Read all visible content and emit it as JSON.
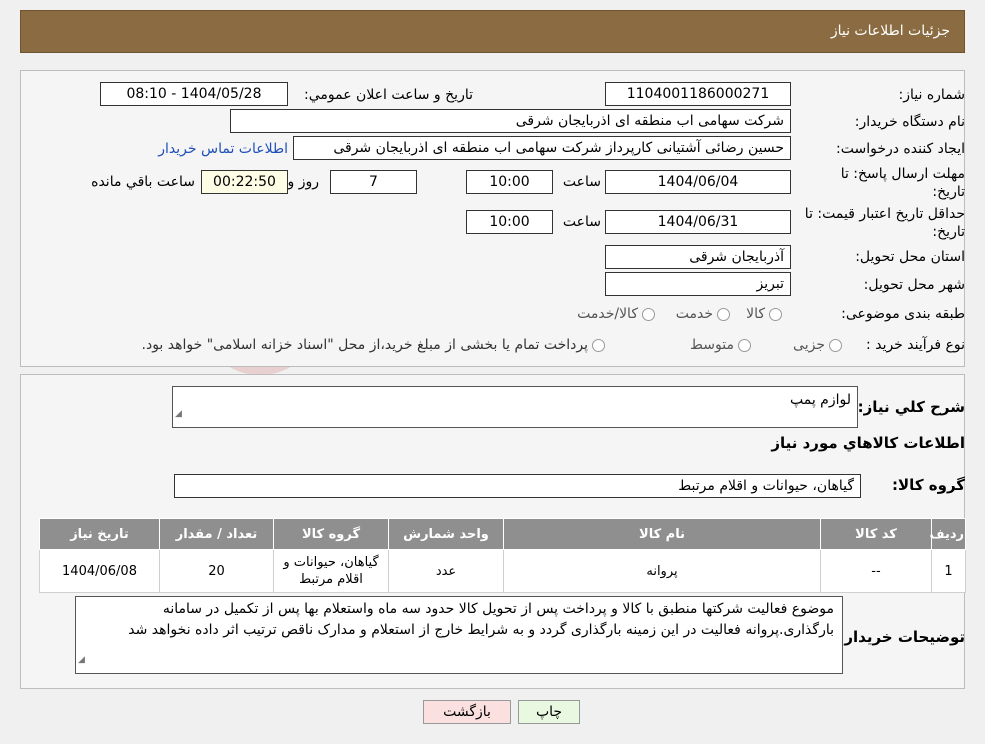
{
  "header": {
    "title": "جزئیات اطلاعات نیاز"
  },
  "form": {
    "need_number_label": "شماره نیاز:",
    "need_number": "1104001186000271",
    "announce_label": "تاریخ و ساعت اعلان عمومي:",
    "announce_value": "1404/05/28 - 08:10",
    "buyer_org_label": "نام دستگاه خريدار:",
    "buyer_org": "شرکت سهامی اب منطقه ای اذربایجان شرقی",
    "creator_label": "ايجاد كننده درخواست:",
    "creator": "حسین رضائی آشتیانی کارپرداز شرکت سهامی اب منطقه ای اذربایجان شرقی",
    "contact_link": "اطلاعات تماس خریدار",
    "deadline_label_1": "مهلت ارسال پاسخ: تا",
    "deadline_label_2": "تاريخ:",
    "deadline_date": "1404/06/04",
    "time_label": "ساعت",
    "deadline_time": "10:00",
    "days_value": "7",
    "days_label": "روز و",
    "remaining_time": "00:22:50",
    "remaining_label": "ساعت باقي مانده",
    "validity_label_1": "حداقل تاريخ اعتبار قيمت: تا",
    "validity_label_2": "تاريخ:",
    "validity_date": "1404/06/31",
    "validity_time_label": "ساعت",
    "validity_time": "10:00",
    "province_label": "استان محل تحويل:",
    "province": "آذربایجان شرقی",
    "city_label": "شهر محل تحويل:",
    "city": "تبریز",
    "category_label": "طبقه بندی موضوعی:",
    "category_options": [
      "کالا",
      "خدمت",
      "کالا/خدمت"
    ],
    "process_label": "نوع فرآيند خريد :",
    "process_options": [
      "جزیی",
      "متوسط"
    ],
    "process_note": "پرداخت تمام یا بخشی از مبلغ خرید،از محل \"اسناد خزانه اسلامی\" خواهد بود."
  },
  "summary": {
    "label": "شرح كلي نياز:",
    "value": "لوازم پمپ",
    "goods_info_title": "اطلاعات كالاهاي مورد نياز",
    "group_label": "گروه کالا:",
    "group_value": "گیاهان، حیوانات و اقلام مرتبط"
  },
  "table": {
    "headers": [
      "رديف",
      "كد كالا",
      "نام كالا",
      "واحد شمارش",
      "گروه كالا",
      "تعداد / مقدار",
      "تاريخ نياز"
    ],
    "rows": [
      [
        "1",
        "--",
        "پروانه",
        "عدد",
        "گیاهان، حیوانات و اقلام مرتبط",
        "20",
        "1404/06/08"
      ]
    ]
  },
  "buyer_notes": {
    "label": "توضيحات خريدار:",
    "text": "موضوع فعالیت شرکتها منطبق با کالا و پرداخت پس از تحویل کالا حدود سه ماه واستعلام بها پس از تکمیل در سامانه بارگذاری.پروانه فعالیت در این زمینه بارگذاری گردد و به شرایط خارج از استعلام و مدارک ناقص ترتیب اثر داده نخواهد شد"
  },
  "buttons": {
    "print": "چاپ",
    "back": "بازگشت"
  },
  "watermark": {
    "text": "AriaTender.neT"
  },
  "colors": {
    "header_bg": "#8b6b41",
    "table_header_bg": "#8f8f8f",
    "print_bg": "#e9f8e1",
    "back_bg": "#fbe0e0",
    "link": "#1f4fb8"
  }
}
